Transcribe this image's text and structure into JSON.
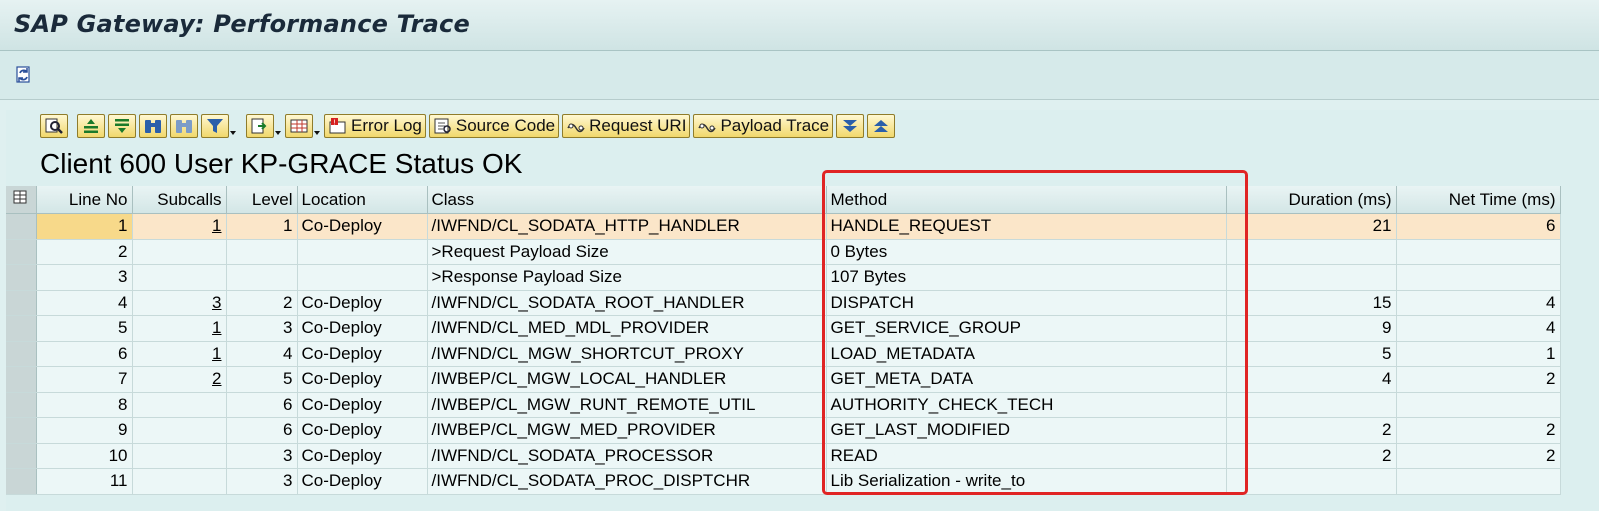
{
  "window": {
    "title": "SAP Gateway: Performance Trace"
  },
  "toolbar_buttons": {
    "error_log": "Error Log",
    "source_code": "Source Code",
    "request_uri": "Request URI",
    "payload_trace": "Payload Trace"
  },
  "header": {
    "text": "Client 600 User KP-GRACE Status OK"
  },
  "table": {
    "columns": {
      "line_no": "Line No",
      "subcalls": "Subcalls",
      "level": "Level",
      "location": "Location",
      "class": "Class",
      "method": "Method",
      "duration": "Duration (ms)",
      "net_time": "Net Time (ms)"
    },
    "rows": [
      {
        "line_no": "1",
        "subcalls": "1",
        "level": "1",
        "location": "Co-Deploy",
        "class": "/IWFND/CL_SODATA_HTTP_HANDLER",
        "method": "HANDLE_REQUEST",
        "duration": "21",
        "net_time": "6"
      },
      {
        "line_no": "2",
        "subcalls": "",
        "level": "",
        "location": "",
        "class": ">Request Payload Size",
        "method": "0 Bytes",
        "duration": "",
        "net_time": ""
      },
      {
        "line_no": "3",
        "subcalls": "",
        "level": "",
        "location": "",
        "class": ">Response Payload Size",
        "method": "107 Bytes",
        "duration": "",
        "net_time": ""
      },
      {
        "line_no": "4",
        "subcalls": "3",
        "level": "2",
        "location": "Co-Deploy",
        "class": "/IWFND/CL_SODATA_ROOT_HANDLER",
        "method": "DISPATCH",
        "duration": "15",
        "net_time": "4"
      },
      {
        "line_no": "5",
        "subcalls": "1",
        "level": "3",
        "location": "Co-Deploy",
        "class": "/IWFND/CL_MED_MDL_PROVIDER",
        "method": "GET_SERVICE_GROUP",
        "duration": "9",
        "net_time": "4"
      },
      {
        "line_no": "6",
        "subcalls": "1",
        "level": "4",
        "location": "Co-Deploy",
        "class": "/IWFND/CL_MGW_SHORTCUT_PROXY",
        "method": "LOAD_METADATA",
        "duration": "5",
        "net_time": "1"
      },
      {
        "line_no": "7",
        "subcalls": "2",
        "level": "5",
        "location": "Co-Deploy",
        "class": "/IWBEP/CL_MGW_LOCAL_HANDLER",
        "method": "GET_META_DATA",
        "duration": "4",
        "net_time": "2"
      },
      {
        "line_no": "8",
        "subcalls": "",
        "level": "6",
        "location": "Co-Deploy",
        "class": "/IWBEP/CL_MGW_RUNT_REMOTE_UTIL",
        "method": "AUTHORITY_CHECK_TECH",
        "duration": "",
        "net_time": ""
      },
      {
        "line_no": "9",
        "subcalls": "",
        "level": "6",
        "location": "Co-Deploy",
        "class": "/IWBEP/CL_MGW_MED_PROVIDER",
        "method": "GET_LAST_MODIFIED",
        "duration": "2",
        "net_time": "2"
      },
      {
        "line_no": "10",
        "subcalls": "",
        "level": "3",
        "location": "Co-Deploy",
        "class": "/IWFND/CL_SODATA_PROCESSOR",
        "method": "READ",
        "duration": "2",
        "net_time": "2"
      },
      {
        "line_no": "11",
        "subcalls": "",
        "level": "3",
        "location": "Co-Deploy",
        "class": "/IWFND/CL_SODATA_PROC_DISPTCHR",
        "method": "Lib Serialization - write_to",
        "duration": "",
        "net_time": ""
      }
    ]
  },
  "colors": {
    "highlight_row": "#fbe6c9",
    "annotation_box": "#e02424"
  }
}
